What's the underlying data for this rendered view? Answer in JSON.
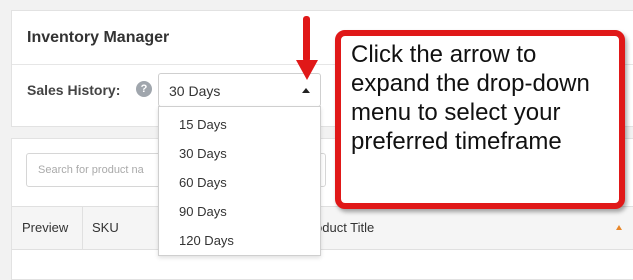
{
  "header": {
    "title": "Inventory Manager"
  },
  "sales_history": {
    "label": "Sales History:",
    "help_icon": "question-circle-icon",
    "help_glyph": "?",
    "selected": "30 Days",
    "options": [
      "15 Days",
      "30 Days",
      "60 Days",
      "90 Days",
      "120 Days"
    ]
  },
  "search": {
    "placeholder": "Search for product na"
  },
  "table": {
    "columns": [
      "Preview",
      "SKU",
      "Product Title"
    ],
    "sort_color": "#e8872a"
  },
  "annotation": {
    "text": "Click the arrow to expand the drop-down menu to select your preferred timeframe",
    "color": "#e01818"
  }
}
